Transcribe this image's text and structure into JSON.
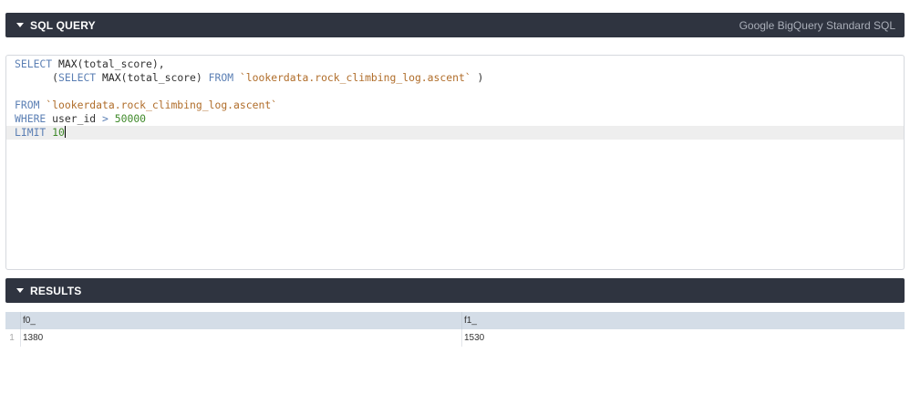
{
  "sql_panel": {
    "title": "SQL QUERY",
    "dialect": "Google BigQuery Standard SQL"
  },
  "editor": {
    "lines": [
      [
        {
          "t": "kw",
          "v": "SELECT "
        },
        {
          "t": "fn",
          "v": "MAX"
        },
        {
          "t": "p",
          "v": "(total_score),"
        }
      ],
      [
        {
          "t": "p",
          "v": "      ("
        },
        {
          "t": "kw",
          "v": "SELECT "
        },
        {
          "t": "fn",
          "v": "MAX"
        },
        {
          "t": "p",
          "v": "(total_score) "
        },
        {
          "t": "kw",
          "v": "FROM "
        },
        {
          "t": "str",
          "v": "`lookerdata.rock_climbing_log.ascent`"
        },
        {
          "t": "p",
          "v": " )"
        }
      ],
      [],
      [
        {
          "t": "kw",
          "v": "FROM "
        },
        {
          "t": "str",
          "v": "`lookerdata.rock_climbing_log.ascent`"
        }
      ],
      [
        {
          "t": "kw",
          "v": "WHERE "
        },
        {
          "t": "p",
          "v": "user_id "
        },
        {
          "t": "kw",
          "v": "> "
        },
        {
          "t": "num",
          "v": "50000"
        }
      ],
      [
        {
          "t": "kw",
          "v": "LIMIT "
        },
        {
          "t": "num",
          "v": "10"
        }
      ]
    ],
    "active_line": 5
  },
  "results_panel": {
    "title": "RESULTS"
  },
  "results": {
    "columns": [
      "f0_",
      "f1_"
    ],
    "rows": [
      {
        "index": "1",
        "cells": [
          "1380",
          "1530"
        ]
      }
    ]
  },
  "colors": {
    "header_bg": "#2f3440",
    "keyword": "#5b7fb4",
    "string": "#b06d2a",
    "number": "#3f8a2a",
    "table_header_bg": "#d4dde7"
  }
}
